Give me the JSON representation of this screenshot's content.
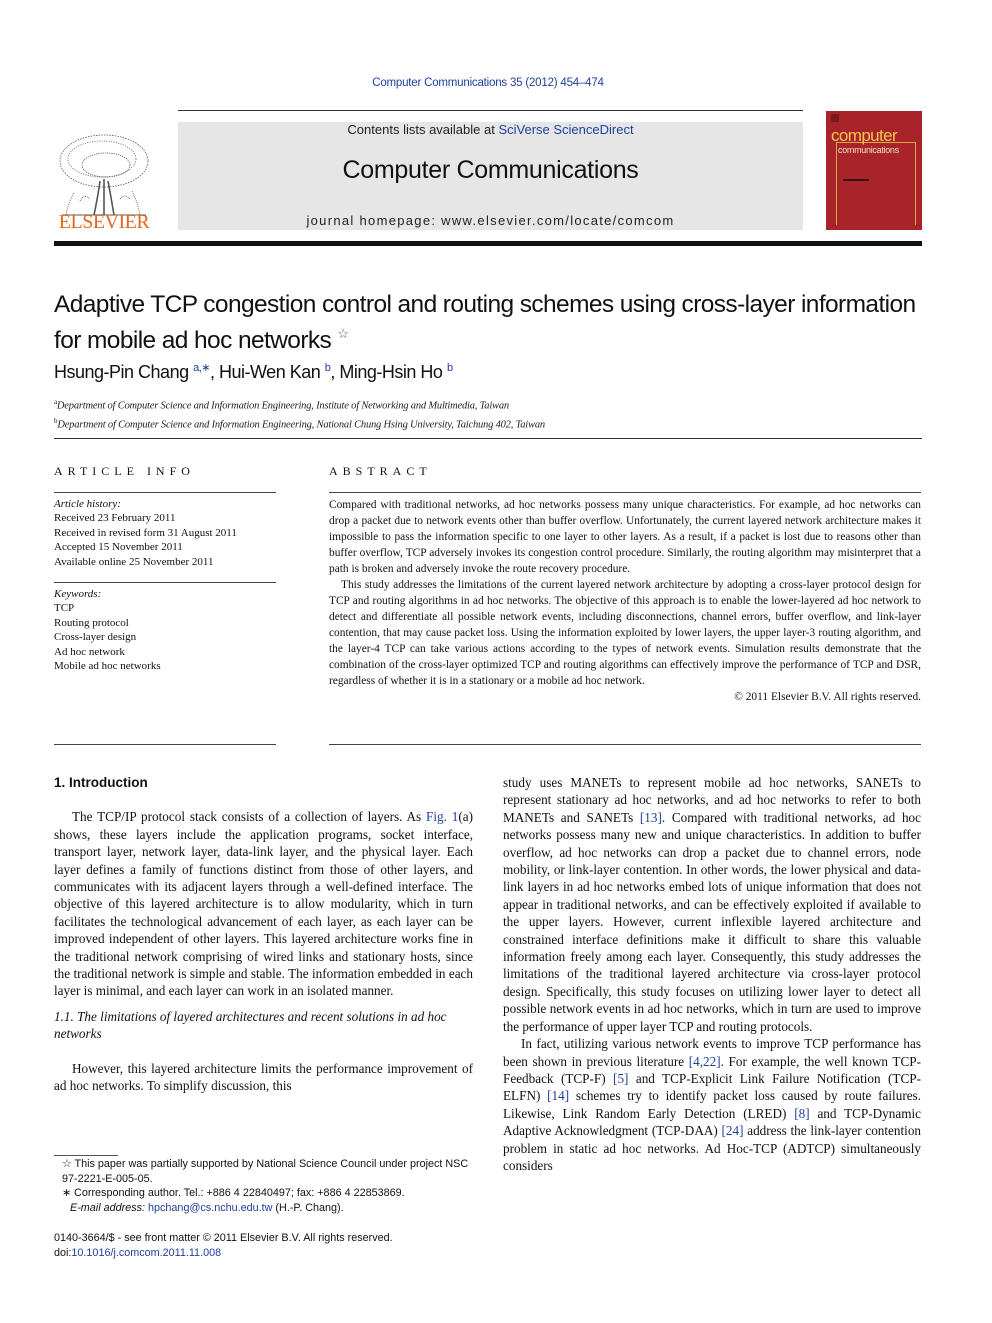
{
  "header": {
    "journal_ref": "Computer Communications 35 (2012) 454–474",
    "publisher_logo_text": "ELSEVIER",
    "contents_prefix": "Contents lists available at ",
    "contents_link": "SciVerse ScienceDirect",
    "journal_title": "Computer Communications",
    "homepage_prefix": "journal homepage: ",
    "homepage_url": "www.elsevier.com/locate/comcom",
    "cover_title_1": "computer",
    "cover_title_2": "communications"
  },
  "article": {
    "title_line1": "Adaptive TCP congestion control and routing schemes using cross-layer information",
    "title_line2": "for mobile ad hoc networks",
    "title_note_mark": "☆",
    "authors": [
      {
        "name": "Hsung-Pin Chang",
        "marks": "a,∗"
      },
      {
        "name": "Hui-Wen Kan",
        "marks": "b"
      },
      {
        "name": "Ming-Hsin Ho",
        "marks": "b"
      }
    ],
    "author_sep": ", ",
    "affiliations": [
      {
        "mark": "a",
        "text": "Department of Computer Science and Information Engineering, Institute of Networking and Multimedia, Taiwan"
      },
      {
        "mark": "b",
        "text": "Department of Computer Science and Information Engineering, National Chung Hsing University, Taichung 402, Taiwan"
      }
    ]
  },
  "article_info": {
    "label": "ARTICLE INFO",
    "history_head": "Article history:",
    "history": [
      "Received 23 February 2011",
      "Received in revised form 31 August 2011",
      "Accepted 15 November 2011",
      "Available online 25 November 2011"
    ],
    "keywords_head": "Keywords:",
    "keywords": [
      "TCP",
      "Routing protocol",
      "Cross-layer design",
      "Ad hoc network",
      "Mobile ad hoc networks"
    ]
  },
  "abstract": {
    "label": "ABSTRACT",
    "p1": "Compared with traditional networks, ad hoc networks possess many unique characteristics. For example, ad hoc networks can drop a packet due to network events other than buffer overflow. Unfortunately, the current layered network architecture makes it impossible to pass the information specific to one layer to other layers. As a result, if a packet is lost due to reasons other than buffer overflow, TCP adversely invokes its congestion control procedure. Similarly, the routing algorithm may misinterpret that a path is broken and adversely invoke the route recovery procedure.",
    "p2": "This study addresses the limitations of the current layered network architecture by adopting a cross-layer protocol design for TCP and routing algorithms in ad hoc networks. The objective of this approach is to enable the lower-layered ad hoc network to detect and differentiate all possible network events, including disconnections, channel errors, buffer overflow, and link-layer contention, that may cause packet loss. Using the information exploited by lower layers, the upper layer-3 routing algorithm, and the layer-4 TCP can take various actions according to the types of network events. Simulation results demonstrate that the combination of the cross-layer optimized TCP and routing algorithms can effectively improve the performance of TCP and DSR, regardless of whether it is in a stationary or a mobile ad hoc network.",
    "copyright": "© 2011 Elsevier B.V. All rights reserved."
  },
  "body": {
    "section1_heading": "1. Introduction",
    "s1p1_link": "Fig. 1",
    "s1p1_pre": "The TCP/IP protocol stack consists of a collection of layers. As ",
    "s1p1_post": "(a) shows, these layers include the application programs, socket interface, transport layer, network layer, data-link layer, and the physical layer. Each layer defines a family of functions distinct from those of other layers, and communicates with its adjacent layers through a well-defined interface. The objective of this layered architecture is to allow modularity, which in turn facilitates the technological advancement of each layer, as each layer can be improved independent of other layers. This layered architecture works fine in the traditional network comprising of wired links and stationary hosts, since the traditional network is simple and stable. The information embedded in each layer is minimal, and each layer can work in an isolated manner.",
    "subsection_heading": "1.1. The limitations of layered architectures and recent solutions in ad hoc networks",
    "s11p1_left": "However, this layered architecture limits the performance improvement of ad hoc networks. To simplify discussion, this",
    "right_p1_a": "study uses MANETs to represent mobile ad hoc networks, SANETs to represent stationary ad hoc networks, and ad hoc networks to refer to both MANETs and SANETs ",
    "ref_13": "[13]",
    "right_p1_b": ". Compared with traditional networks, ad hoc networks possess many new and unique characteristics. In addition to buffer overflow, ad hoc networks can drop a packet due to channel errors, node mobility, or link-layer contention. In other words, the lower physical and data-link layers in ad hoc networks embed lots of unique information that does not appear in traditional networks, and can be effectively exploited if available to the upper layers. However, current inflexible layered architecture and constrained interface definitions make it difficult to share this valuable information freely among each layer. Consequently, this study addresses the limitations of the traditional layered architecture via cross-layer protocol design. Specifically, this study focuses on utilizing lower layer to detect all possible network events in ad hoc networks, which in turn are used to improve the performance of upper layer TCP and routing protocols.",
    "right_p2_a": "In fact, utilizing various network events to improve TCP performance has been shown in previous literature ",
    "ref_4_22": "[4,22]",
    "right_p2_b": ". For example, the well known TCP-Feedback (TCP-F) ",
    "ref_5": "[5]",
    "right_p2_c": " and TCP-Explicit Link Failure Notification (TCP-ELFN) ",
    "ref_14": "[14]",
    "right_p2_d": " schemes try to identify packet loss caused by route failures. Likewise, Link Random Early Detection (LRED) ",
    "ref_8": "[8]",
    "right_p2_e": " and TCP-Dynamic Adaptive Acknowledgment (TCP-DAA) ",
    "ref_24": "[24]",
    "right_p2_f": " address the link-layer contention problem in static ad hoc networks. Ad Hoc-TCP (ADTCP) simultaneously considers"
  },
  "footnotes": {
    "fn1_mark": "☆",
    "fn1_text": " This paper was partially supported by National Science Council under project NSC 97-2221-E-005-05.",
    "fn2_mark": "∗",
    "fn2_text": " Corresponding author. Tel.: +886 4 22840497; fax: +886 4 22853869.",
    "email_label": "E-mail address: ",
    "email": "hpchang@cs.nchu.edu.tw",
    "email_suffix": " (H.-P. Chang).",
    "issn_line": "0140-3664/$ - see front matter © 2011 Elsevier B.V. All rights reserved.",
    "doi_prefix": "doi:",
    "doi": "10.1016/j.comcom.2011.11.008"
  },
  "colors": {
    "link": "#1f3f9c",
    "elsevier_orange": "#e3681c",
    "cover_red": "#a8242a",
    "banner_gray": "#e6e6e6"
  }
}
